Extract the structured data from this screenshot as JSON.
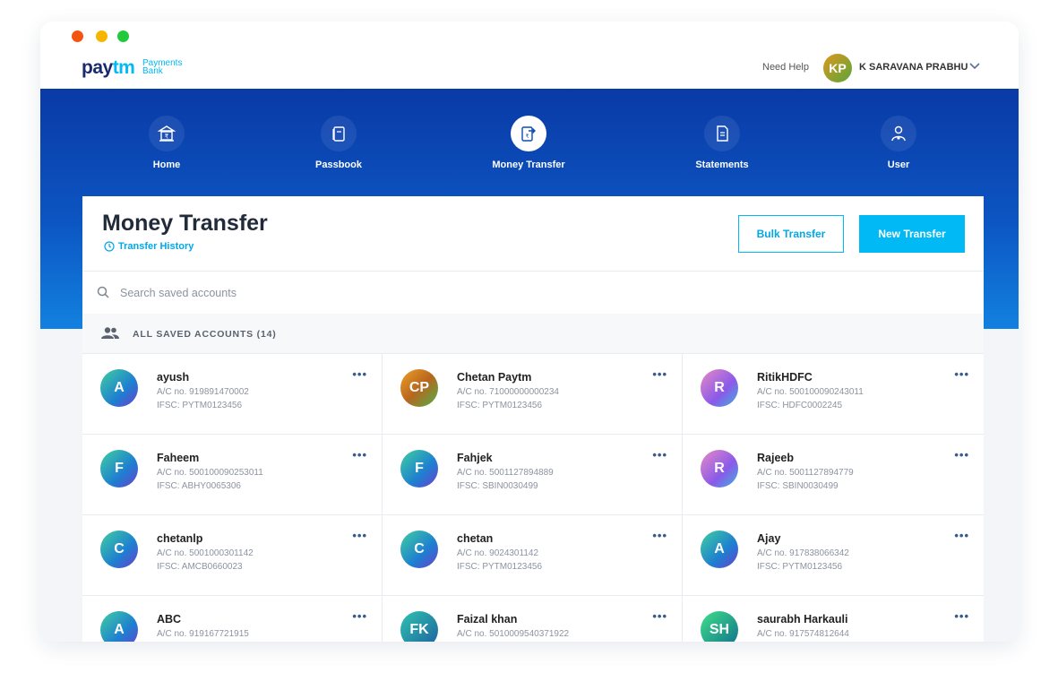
{
  "header": {
    "logo_main_pay": "pay",
    "logo_main_tm": "tm",
    "logo_sub": "Payments Bank",
    "need_help": "Need Help",
    "user_initials": "KP",
    "user_name": "K SARAVANA PRABHU"
  },
  "nav": {
    "items": [
      {
        "label": "Home",
        "icon": "bank-icon"
      },
      {
        "label": "Passbook",
        "icon": "passbook-icon"
      },
      {
        "label": "Money Transfer",
        "icon": "money-transfer-icon"
      },
      {
        "label": "Statements",
        "icon": "statement-icon"
      },
      {
        "label": "User",
        "icon": "user-settings-icon"
      }
    ],
    "active": "Money Transfer"
  },
  "page": {
    "title": "Money Transfer",
    "history_link": "Transfer History",
    "bulk_transfer": "Bulk Transfer",
    "new_transfer": "New Transfer"
  },
  "search": {
    "placeholder": "Search saved accounts"
  },
  "saved": {
    "section_label": "ALL SAVED ACCOUNTS (14)",
    "accounts": [
      {
        "initials": "A",
        "name": "ayush",
        "acno": "A/C no. 919891470002",
        "ifsc": "IFSC: PYTM0123456",
        "color": "#2ab0c4"
      },
      {
        "initials": "CP",
        "name": "Chetan Paytm",
        "acno": "A/C no. 71000000000234",
        "ifsc": "IFSC: PYTM0123456",
        "color": "#d9892a"
      },
      {
        "initials": "R",
        "name": "RitikHDFC",
        "acno": "A/C no. 500100090243011",
        "ifsc": "IFSC: HDFC0002245",
        "color": "#b66ad9"
      },
      {
        "initials": "F",
        "name": "Faheem",
        "acno": "A/C no. 500100090253011",
        "ifsc": "IFSC: ABHY0065306",
        "color": "#2aa0c0"
      },
      {
        "initials": "F",
        "name": "Fahjek",
        "acno": "A/C no. 5001127894889",
        "ifsc": "IFSC: SBIN0030499",
        "color": "#2aa0c0"
      },
      {
        "initials": "R",
        "name": "Rajeeb",
        "acno": "A/C no. 5001127894779",
        "ifsc": "IFSC: SBIN0030499",
        "color": "#b66ad9"
      },
      {
        "initials": "C",
        "name": "chetanlp",
        "acno": "A/C no. 5001000301142",
        "ifsc": "IFSC: AMCB0660023",
        "color": "#2ab0c4"
      },
      {
        "initials": "C",
        "name": "chetan",
        "acno": "A/C no. 9024301142",
        "ifsc": "IFSC: PYTM0123456",
        "color": "#2ab0c4"
      },
      {
        "initials": "A",
        "name": "Ajay",
        "acno": "A/C no. 917838066342",
        "ifsc": "IFSC: PYTM0123456",
        "color": "#2ab0c4"
      },
      {
        "initials": "A",
        "name": "ABC",
        "acno": "A/C no. 919167721915",
        "ifsc": "",
        "color": "#2ab0c4"
      },
      {
        "initials": "FK",
        "name": "Faizal khan",
        "acno": "A/C no. 5010009540371922",
        "ifsc": "",
        "color": "#1f7ea0"
      },
      {
        "initials": "SH",
        "name": "saurabh Harkauli",
        "acno": "A/C no. 917574812644",
        "ifsc": "",
        "color": "#1f9a6a"
      }
    ]
  }
}
